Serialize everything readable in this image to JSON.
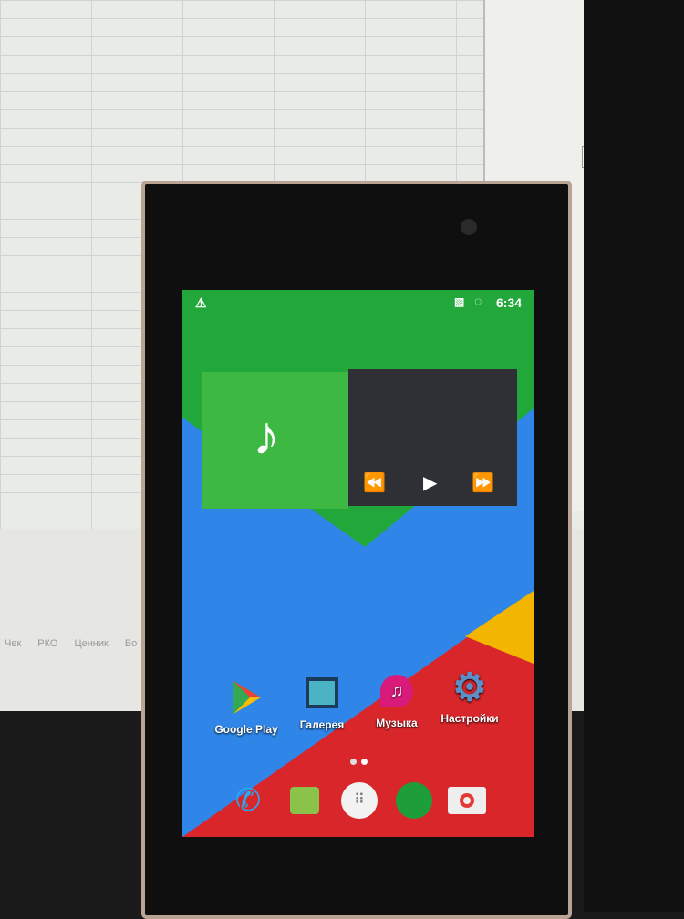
{
  "background_monitor": {
    "tabs": [
      "Чек",
      "РКО",
      "Ценник",
      "Во"
    ],
    "dialog_buttons": [
      "...",
      "✕"
    ]
  },
  "status_bar": {
    "time": "6:34",
    "icons": [
      "warning-icon",
      "no-sim-icon",
      "loading-icon"
    ]
  },
  "music_widget": {
    "icons": [
      "music-note-icon",
      "rewind-icon",
      "play-icon",
      "fast-forward-icon"
    ],
    "art_color": "#3db843"
  },
  "apps": [
    {
      "label": "Google Play",
      "icon": "google-play-icon"
    },
    {
      "label": "Галерея",
      "icon": "gallery-icon"
    },
    {
      "label": "Музыка",
      "icon": "music-icon"
    },
    {
      "label": "Настройки",
      "icon": "settings-icon"
    }
  ],
  "page_indicator": {
    "pages": 2,
    "current": 1
  },
  "dock": [
    "phone-icon",
    "messaging-icon",
    "app-drawer-icon",
    "hangouts-icon",
    "camera-icon"
  ],
  "wallpaper_colors": {
    "green": "#22a83a",
    "blue": "#2f86e8",
    "red": "#d8262a",
    "yellow": "#f2b600"
  }
}
